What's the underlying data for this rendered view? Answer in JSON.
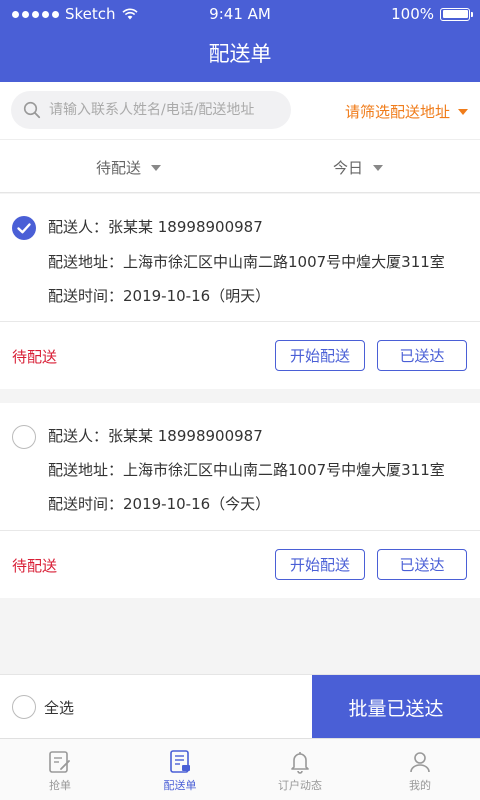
{
  "status_bar": {
    "carrier": "Sketch",
    "time": "9:41 AM",
    "battery": "100%"
  },
  "header": {
    "title": "配送单"
  },
  "search": {
    "placeholder": "请输入联系人姓名/电话/配送地址",
    "address_filter": "请筛选配送地址"
  },
  "filters": {
    "status": "待配送",
    "date": "今日"
  },
  "orders": [
    {
      "selected": true,
      "contact": "配送人：张某某   18998900987",
      "address": "配送地址：上海市徐汇区中山南二路1007号中煌大厦311室",
      "time": "配送时间：2019-10-16（明天）",
      "status": "待配送",
      "start_label": "开始配送",
      "done_label": "已送达"
    },
    {
      "selected": false,
      "contact": "配送人：张某某   18998900987",
      "address": "配送地址：上海市徐汇区中山南二路1007号中煌大厦311室",
      "time": "配送时间：2019-10-16（今天）",
      "status": "待配送",
      "start_label": "开始配送",
      "done_label": "已送达"
    }
  ],
  "bottom": {
    "select_all": "全选",
    "batch": "批量已送达"
  },
  "tabs": [
    {
      "label": "抢单",
      "icon": "grab-order-icon"
    },
    {
      "label": "配送单",
      "icon": "delivery-order-icon"
    },
    {
      "label": "订户动态",
      "icon": "bell-icon"
    },
    {
      "label": "我的",
      "icon": "user-icon"
    }
  ],
  "colors": {
    "primary": "#4a5fd6",
    "accent": "#f07c1a",
    "status": "#d81e35"
  }
}
